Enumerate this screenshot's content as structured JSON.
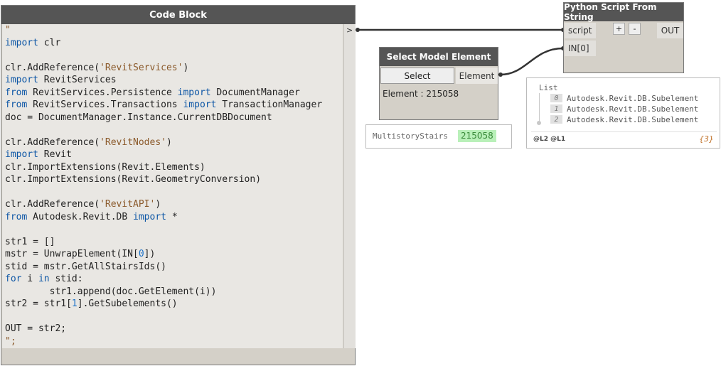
{
  "code_block": {
    "title": "Code Block",
    "port_label": ">",
    "lines": [
      [
        {
          "t": "\"",
          "c": "str"
        }
      ],
      [
        {
          "t": "import",
          "c": "kw"
        },
        {
          "t": " clr",
          "c": ""
        }
      ],
      [],
      [
        {
          "t": "clr.AddReference(",
          "c": ""
        },
        {
          "t": "'RevitServices'",
          "c": "str"
        },
        {
          "t": ")",
          "c": ""
        }
      ],
      [
        {
          "t": "import",
          "c": "kw"
        },
        {
          "t": " RevitServices",
          "c": ""
        }
      ],
      [
        {
          "t": "from",
          "c": "kw"
        },
        {
          "t": " RevitServices.Persistence ",
          "c": ""
        },
        {
          "t": "import",
          "c": "kw"
        },
        {
          "t": " DocumentManager",
          "c": ""
        }
      ],
      [
        {
          "t": "from",
          "c": "kw"
        },
        {
          "t": " RevitServices.Transactions ",
          "c": ""
        },
        {
          "t": "import",
          "c": "kw"
        },
        {
          "t": " TransactionManager",
          "c": ""
        }
      ],
      [
        {
          "t": "doc = DocumentManager.Instance.CurrentDBDocument",
          "c": ""
        }
      ],
      [],
      [
        {
          "t": "clr.AddReference(",
          "c": ""
        },
        {
          "t": "'RevitNodes'",
          "c": "str"
        },
        {
          "t": ")",
          "c": ""
        }
      ],
      [
        {
          "t": "import",
          "c": "kw"
        },
        {
          "t": " Revit",
          "c": ""
        }
      ],
      [
        {
          "t": "clr.ImportExtensions(Revit.Elements)",
          "c": ""
        }
      ],
      [
        {
          "t": "clr.ImportExtensions(Revit.GeometryConversion)",
          "c": ""
        }
      ],
      [],
      [
        {
          "t": "clr.AddReference(",
          "c": ""
        },
        {
          "t": "'RevitAPI'",
          "c": "str"
        },
        {
          "t": ")",
          "c": ""
        }
      ],
      [
        {
          "t": "from",
          "c": "kw"
        },
        {
          "t": " Autodesk.Revit.DB ",
          "c": ""
        },
        {
          "t": "import",
          "c": "kw"
        },
        {
          "t": " *",
          "c": ""
        }
      ],
      [],
      [
        {
          "t": "str1 = []",
          "c": ""
        }
      ],
      [
        {
          "t": "mstr = UnwrapElement(IN[",
          "c": ""
        },
        {
          "t": "0",
          "c": "num"
        },
        {
          "t": "])",
          "c": ""
        }
      ],
      [
        {
          "t": "stid = mstr.GetAllStairsIds()",
          "c": ""
        }
      ],
      [
        {
          "t": "for",
          "c": "kw"
        },
        {
          "t": " i ",
          "c": ""
        },
        {
          "t": "in",
          "c": "kw"
        },
        {
          "t": " stid:",
          "c": ""
        }
      ],
      [
        {
          "t": "        str1.append(doc.GetElement(i))",
          "c": ""
        }
      ],
      [
        {
          "t": "str2 = str1[",
          "c": ""
        },
        {
          "t": "1",
          "c": "num"
        },
        {
          "t": "].GetSubelements()",
          "c": ""
        }
      ],
      [],
      [
        {
          "t": "OUT = str2;",
          "c": ""
        }
      ],
      [
        {
          "t": "\";",
          "c": "str"
        }
      ]
    ]
  },
  "python_node": {
    "title": "Python Script From String",
    "in_script": "script",
    "in_0": "IN[0]",
    "add_label": "+",
    "remove_label": "-",
    "out_label": "OUT"
  },
  "select_node": {
    "title": "Select Model Element",
    "button_label": "Select",
    "out_label": "Element",
    "info": "Element : 215058"
  },
  "stairs_preview": {
    "label": "MultistoryStairs",
    "id": "215058"
  },
  "list_preview": {
    "title": "List",
    "items": [
      {
        "index": "0",
        "value": "Autodesk.Revit.DB.Subelement"
      },
      {
        "index": "1",
        "value": "Autodesk.Revit.DB.Subelement"
      },
      {
        "index": "2",
        "value": "Autodesk.Revit.DB.Subelement"
      }
    ],
    "levels": "@L2 @L1",
    "count": "{3}"
  },
  "colors": {
    "node_title": "#555555",
    "node_body": "#d4d0c8",
    "keyword": "#0e57a6",
    "string": "#8b5a2b",
    "wire": "#333333",
    "highlight_green": "#b9f0b9"
  }
}
